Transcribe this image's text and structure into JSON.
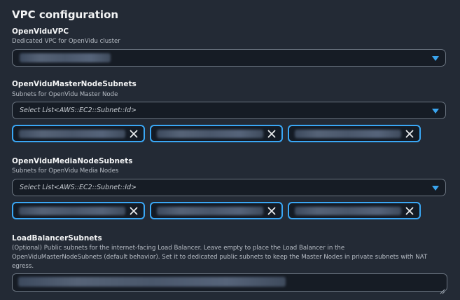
{
  "section": {
    "title": "VPC configuration"
  },
  "vpc": {
    "label": "OpenViduVPC",
    "description": "Dedicated VPC for OpenVidu cluster"
  },
  "master_subnets": {
    "label": "OpenViduMasterNodeSubnets",
    "description": "Subnets for OpenVidu Master Node",
    "placeholder": "Select List<AWS::EC2::Subnet::Id>",
    "remove_icon": "close-icon"
  },
  "media_subnets": {
    "label": "OpenViduMediaNodeSubnets",
    "description": "Subnets for OpenVidu Media Nodes",
    "placeholder": "Select List<AWS::EC2::Subnet::Id>",
    "remove_icon": "close-icon"
  },
  "lb_subnets": {
    "label": "LoadBalancerSubnets",
    "description_lines": [
      "(Optional) Public subnets for the internet-facing Load Balancer. Leave empty to place the Load Balancer in the",
      "OpenViduMasterNodeSubnets (default behavior). Set it to dedicated public subnets to keep the Master Nodes in private subnets with NAT",
      "egress."
    ]
  },
  "colors": {
    "background": "#232a35",
    "accent": "#3aa7f5",
    "input_border": "#6b7581",
    "input_bg": "#161c25"
  },
  "icons": {
    "dropdown": "caret-down-icon",
    "remove": "close-icon",
    "resize": "resize-grip-icon"
  }
}
